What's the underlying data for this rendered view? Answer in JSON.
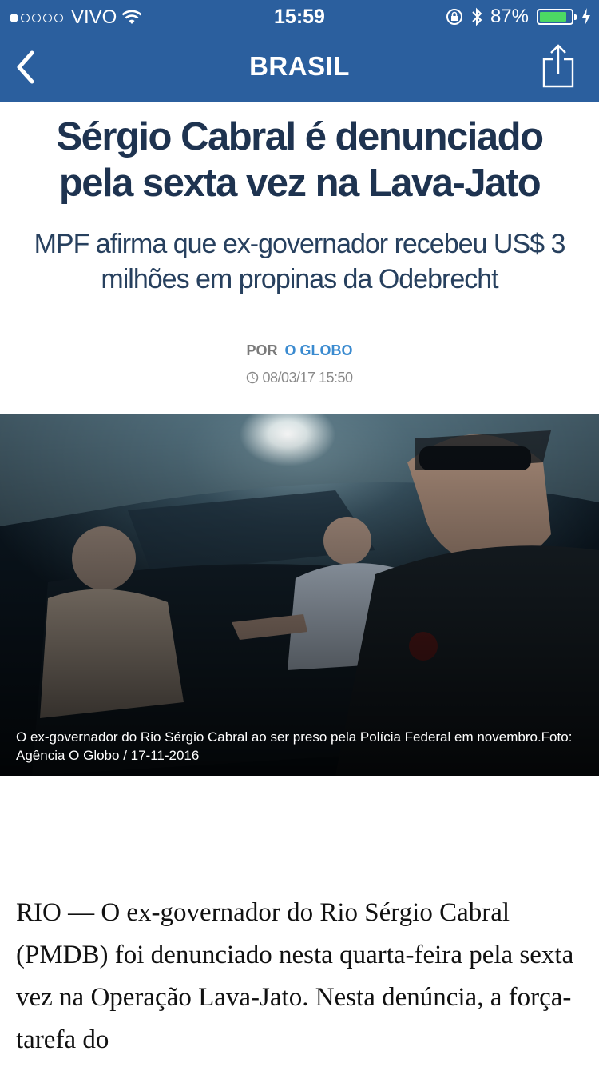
{
  "status_bar": {
    "carrier": "VIVO",
    "time": "15:59",
    "battery_percent": "87%",
    "battery_level": 0.87,
    "signal_bars_filled": 1,
    "signal_bars_total": 5
  },
  "nav": {
    "title": "BRASIL",
    "back_icon": "chevron-left-icon",
    "share_icon": "share-icon",
    "bar_color": "#2b5f9e"
  },
  "article": {
    "headline": "Sérgio Cabral é denunciado pela sexta vez na Lava-Jato",
    "subheadline": "MPF afirma que ex-governador recebeu US$ 3 milhões em propinas da Odebrecht",
    "byline_prefix": "POR",
    "source": "O GLOBO",
    "date": "08/03/17 15:50",
    "photo_caption": "O ex-governador do Rio Sérgio Cabral ao ser preso pela Polícia Federal em novembro.Foto: Agência O Globo / 17-11-2016",
    "body": "RIO — O ex-governador do Rio Sérgio Cabral (PMDB) foi denunciado nesta quarta-feira pela sexta vez na Operação Lava-Jato. Nesta denúncia, a força-tarefa do"
  },
  "colors": {
    "headline": "#1e3350",
    "source_link": "#3b8bd0",
    "battery_fill": "#4cd964"
  }
}
